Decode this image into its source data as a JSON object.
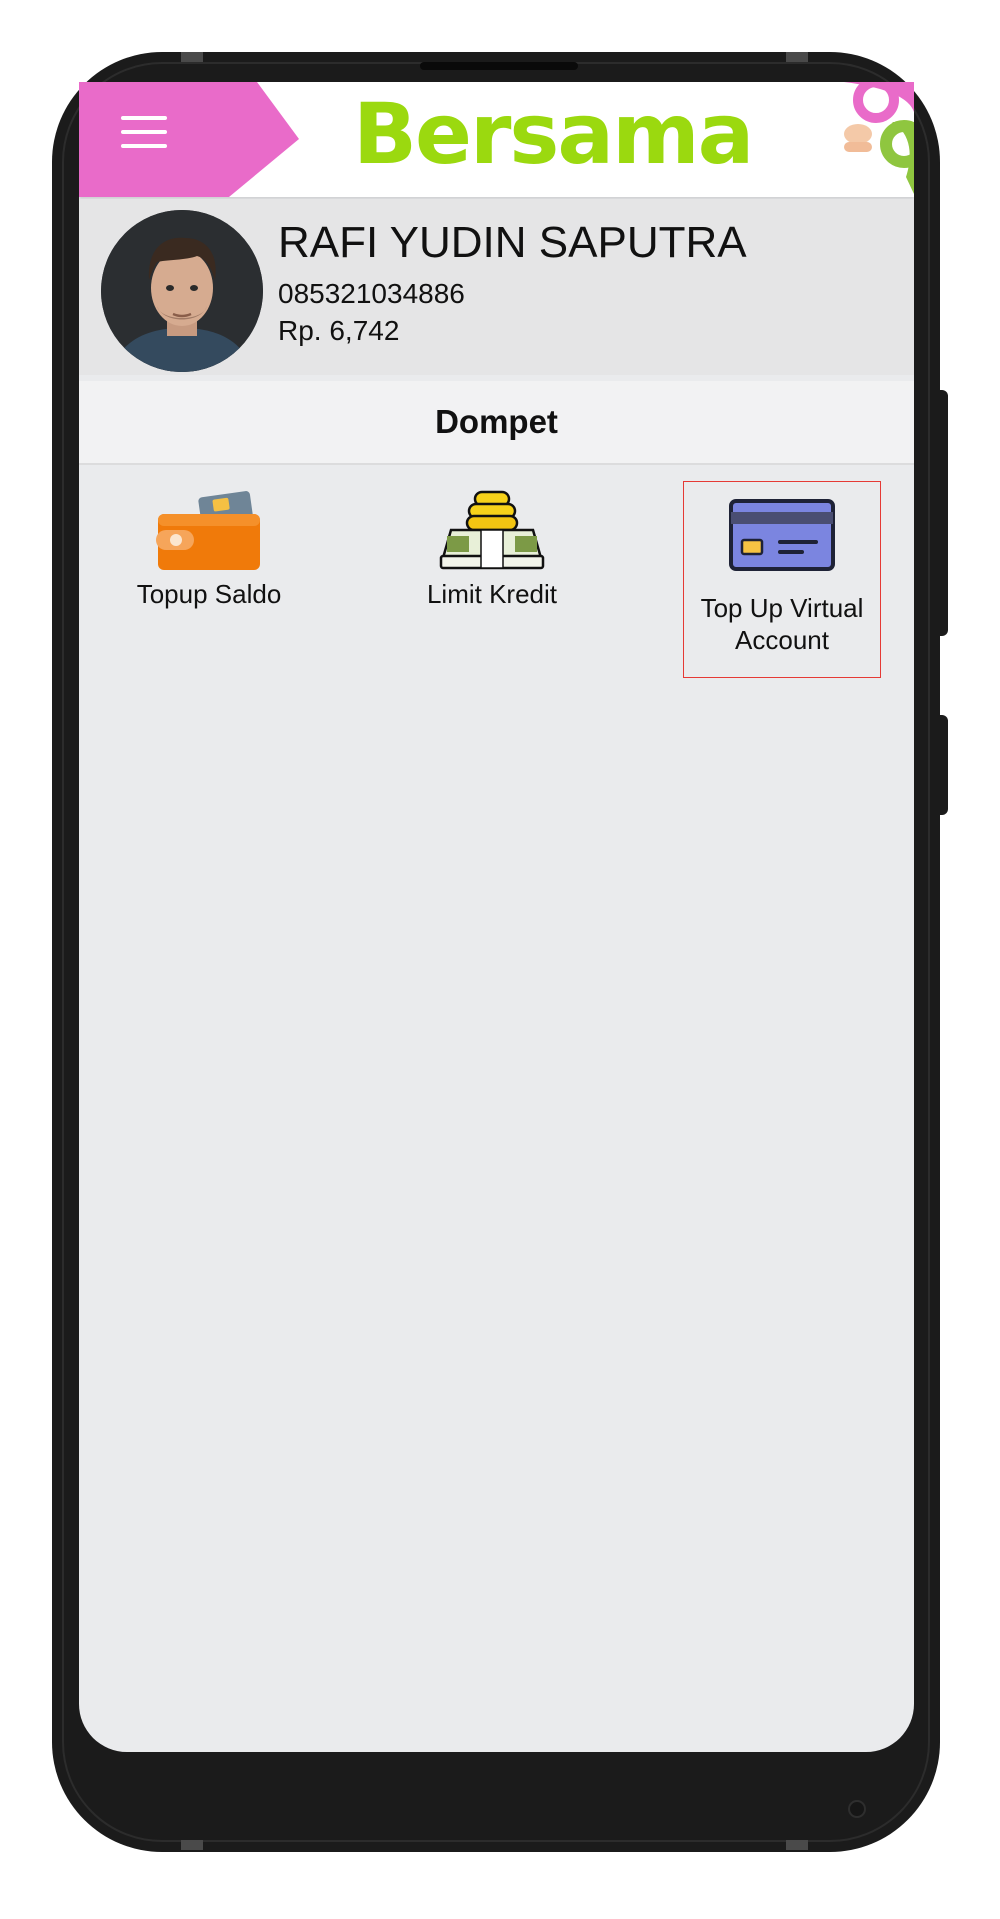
{
  "app": {
    "brand": "Bersama"
  },
  "profile": {
    "name": "RAFI YUDIN SAPUTRA",
    "phone": "085321034886",
    "balance": "Rp. 6,742"
  },
  "section": {
    "title": "Dompet"
  },
  "menu": {
    "items": [
      {
        "label": "Topup Saldo",
        "icon": "wallet-icon"
      },
      {
        "label": "Limit Kredit",
        "icon": "money-stack-icon"
      },
      {
        "label_line1": "Top Up Virtual",
        "label_line2": "Account",
        "icon": "credit-card-icon"
      }
    ]
  },
  "colors": {
    "menu_tab": "#e96bc9",
    "brand_green": "#9bd90f",
    "highlight_border": "#e53935",
    "screen_bg": "#eaebed"
  }
}
